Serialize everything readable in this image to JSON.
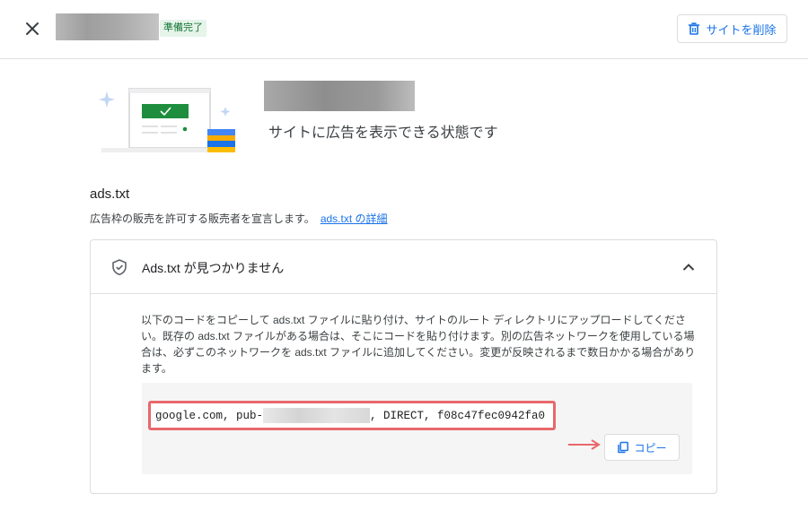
{
  "header": {
    "status_badge": "準備完了",
    "delete_label": "サイトを削除"
  },
  "hero": {
    "ready_text": "サイトに広告を表示できる状態です"
  },
  "section": {
    "title": "ads.txt",
    "description": "広告枠の販売を許可する販売者を宣言します。",
    "link_label": "ads.txt の詳細"
  },
  "card": {
    "title": "Ads.txt が見つかりません",
    "instructions": "以下のコードをコピーして ads.txt ファイルに貼り付け、サイトのルート ディレクトリにアップロードしてください。既存の ads.txt ファイルがある場合は、そこにコードを貼り付けます。別の広告ネットワークを使用している場合は、必ずこのネットワークを ads.txt ファイルに追加してください。変更が反映されるまで数日かかる場合があります。",
    "code_prefix": "google.com, pub-",
    "code_suffix": ", DIRECT, f08c47fec0942fa0",
    "copy_label": "コピー"
  },
  "colors": {
    "accent": "#1a73e8",
    "badge_bg": "#e6f4ea",
    "badge_text": "#137333",
    "highlight": "#e8686c",
    "illustration_green": "#1e8e3e"
  }
}
